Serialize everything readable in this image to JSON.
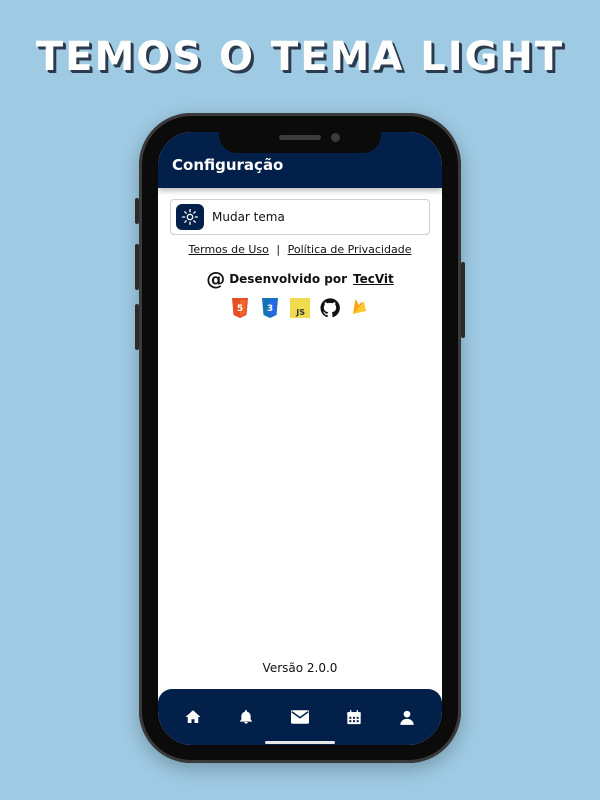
{
  "headline": "Temos o tema light",
  "app": {
    "title": "Configuração",
    "theme_button_label": "Mudar tema",
    "links": {
      "terms": "Termos de Uso",
      "separator": "|",
      "privacy": "Política de Privacidade"
    },
    "developer": {
      "at_symbol": "@",
      "prefix": "Desenvolvido por",
      "brand": "TecVit"
    },
    "techs": [
      {
        "icon": "html5-icon",
        "color": "#e34f26"
      },
      {
        "icon": "css3-icon",
        "color": "#2965f1"
      },
      {
        "icon": "javascript-icon",
        "color": "#f0db4f",
        "text": "JS"
      },
      {
        "icon": "github-icon",
        "color": "#111111"
      },
      {
        "icon": "firebase-icon",
        "color": "#ffa000"
      }
    ],
    "version": "Versão 2.0.0",
    "nav": [
      "home-icon",
      "bell-icon",
      "mail-icon",
      "calendar-icon",
      "user-icon"
    ]
  },
  "colors": {
    "background": "#9ecae3",
    "primary": "#03204a"
  }
}
